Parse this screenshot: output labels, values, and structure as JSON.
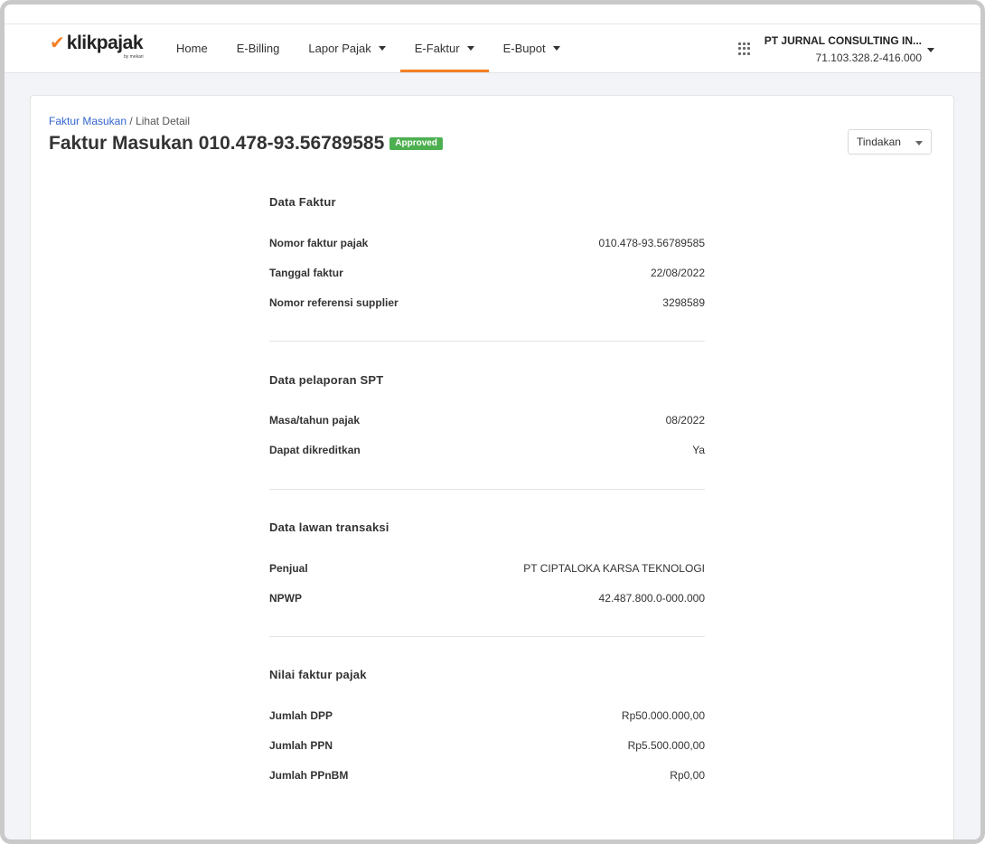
{
  "brand": {
    "name": "klikpajak",
    "byline": "by mekari"
  },
  "nav": [
    {
      "label": "Home",
      "dropdown": false,
      "active": false
    },
    {
      "label": "E-Billing",
      "dropdown": false,
      "active": false
    },
    {
      "label": "Lapor Pajak",
      "dropdown": true,
      "active": false
    },
    {
      "label": "E-Faktur",
      "dropdown": true,
      "active": true
    },
    {
      "label": "E-Bupot",
      "dropdown": true,
      "active": false
    }
  ],
  "company": {
    "name": "PT JURNAL CONSULTING IN...",
    "npwp": "71.103.328.2-416.000"
  },
  "breadcrumb": {
    "parent": "Faktur Masukan",
    "separator": " / ",
    "current": "Lihat Detail"
  },
  "page": {
    "title": "Faktur Masukan 010.478-93.56789585",
    "status": "Approved",
    "action_label": "Tindakan"
  },
  "sections": [
    {
      "title": "Data Faktur",
      "rows": [
        {
          "label": "Nomor faktur pajak",
          "value": "010.478-93.56789585"
        },
        {
          "label": "Tanggal faktur",
          "value": "22/08/2022"
        },
        {
          "label": "Nomor referensi supplier",
          "value": "3298589"
        }
      ]
    },
    {
      "title": "Data pelaporan SPT",
      "rows": [
        {
          "label": "Masa/tahun pajak",
          "value": "08/2022"
        },
        {
          "label": "Dapat dikreditkan",
          "value": "Ya"
        }
      ]
    },
    {
      "title": "Data lawan transaksi",
      "rows": [
        {
          "label": "Penjual",
          "value": "PT CIPTALOKA KARSA TEKNOLOGI"
        },
        {
          "label": "NPWP",
          "value": "42.487.800.0-000.000"
        }
      ]
    },
    {
      "title": "Nilai faktur pajak",
      "rows": [
        {
          "label": "Jumlah DPP",
          "value": "Rp50.000.000,00"
        },
        {
          "label": "Jumlah PPN",
          "value": "Rp5.500.000,00"
        },
        {
          "label": "Jumlah PPnBM",
          "value": "Rp0,00"
        }
      ]
    }
  ],
  "colors": {
    "accent": "#f58025",
    "status_approved": "#4caf50",
    "link": "#3366cc"
  }
}
